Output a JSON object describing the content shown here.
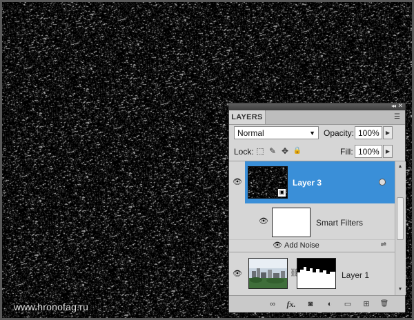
{
  "watermark": "www.hronofag.ru",
  "panel": {
    "tab_label": "LAYERS",
    "collapse_glyph": "◂◂",
    "close_glyph": "✕",
    "menu_glyph": "☰",
    "blend_mode": "Normal",
    "opacity_label": "Opacity:",
    "opacity_value": "100%",
    "lock_label": "Lock:",
    "fill_label": "Fill:",
    "fill_value": "100%"
  },
  "layers": {
    "layer3_name": "Layer 3",
    "smart_filters_label": "Smart Filters",
    "filter_name": "Add Noise",
    "layer1_name": "Layer 1"
  },
  "icons": {
    "eye": "👁",
    "chain": "⛓",
    "lock_transparent": "⬚",
    "lock_brush": "✎",
    "lock_move": "✥",
    "lock_all": "🔒",
    "link": "∞",
    "fx": "fx.",
    "mask": "◙",
    "adjust": "◐",
    "folder": "▭",
    "new_layer": "⊞",
    "trash": "🗑",
    "sliders": "⇌"
  },
  "colors": {
    "selection": "#3a8fd8",
    "panel_bg": "#d6d6d6"
  }
}
